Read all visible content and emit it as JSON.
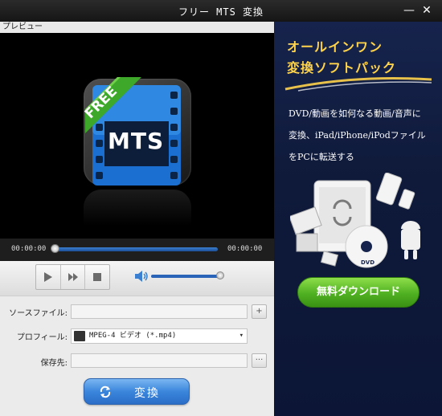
{
  "window": {
    "title": "フリー MTS 変換",
    "minimize_glyph": "—",
    "close_glyph": "✕"
  },
  "preview": {
    "label": "プレビュー",
    "logo_badge": "FREE",
    "logo_text": "MTS"
  },
  "player": {
    "current_time": "00:00:00",
    "total_time": "00:00:00",
    "progress": 0,
    "volume": 0.95,
    "buttons": [
      "play-icon",
      "fast-forward-icon",
      "stop-icon"
    ]
  },
  "form": {
    "source_label": "ソースファイル:",
    "source_value": "",
    "source_btn": "+",
    "profile_label": "プロフィール:",
    "profile_value": "MPEG-4 ビデオ (*.mp4)",
    "dest_label": "保存先:",
    "dest_value": "",
    "dest_btn": "···",
    "convert_label": "変換"
  },
  "ad": {
    "headline_1": "オールインワン",
    "headline_2": "変換ソフトパック",
    "desc_1": "DVD/動画を如何なる動画/音声に",
    "desc_2": "変換、iPad/iPhone/iPodファイル",
    "desc_3": "をPCに転送する",
    "dvd_label": "DVD",
    "download_label": "無料ダウンロード"
  },
  "colors": {
    "accent_blue": "#3b86dc",
    "ad_yellow": "#ffd34a",
    "download_green": "#4fb021",
    "ad_background": "#16234c"
  }
}
